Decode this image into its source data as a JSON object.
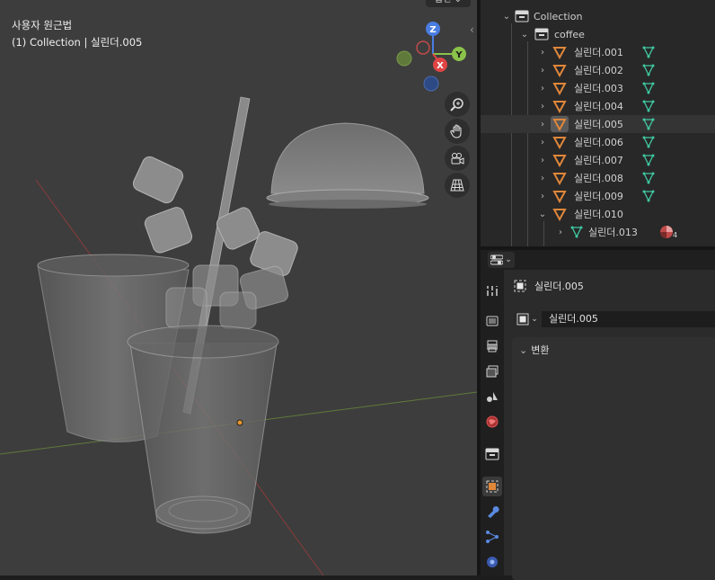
{
  "viewport": {
    "title": "사용자 원근법",
    "subtitle": "(1) Collection | 실린더.005",
    "top_menu": "옵션",
    "gizmo": {
      "z": "Z",
      "y": "Y",
      "x": "X"
    },
    "buttons": [
      "zoom-icon",
      "hand-icon",
      "camera-icon",
      "grid-icon"
    ],
    "colors": {
      "background": "#3d3d3d",
      "x_axis": "#e04545",
      "y_axis": "#8ac24a",
      "z_axis": "#4a7de0"
    }
  },
  "outliner": {
    "items": [
      {
        "label": "Collection",
        "indent": 1,
        "icon": "collection-icon",
        "expanded": true
      },
      {
        "label": "coffee",
        "indent": 2,
        "icon": "collection-icon",
        "expanded": true
      },
      {
        "label": "실린더.001",
        "indent": 3,
        "icon": "mesh-object-icon"
      },
      {
        "label": "실린더.002",
        "indent": 3,
        "icon": "mesh-object-icon"
      },
      {
        "label": "실린더.003",
        "indent": 3,
        "icon": "mesh-object-icon"
      },
      {
        "label": "실린더.004",
        "indent": 3,
        "icon": "mesh-object-icon"
      },
      {
        "label": "실린더.005",
        "indent": 3,
        "icon": "mesh-object-icon",
        "selected": true
      },
      {
        "label": "실린더.006",
        "indent": 3,
        "icon": "mesh-object-icon"
      },
      {
        "label": "실린더.007",
        "indent": 3,
        "icon": "mesh-object-icon"
      },
      {
        "label": "실린더.008",
        "indent": 3,
        "icon": "mesh-object-icon"
      },
      {
        "label": "실린더.009",
        "indent": 3,
        "icon": "mesh-object-icon"
      },
      {
        "label": "실린더.010",
        "indent": 3,
        "icon": "mesh-object-icon",
        "expanded": true
      },
      {
        "label": "실린더.013",
        "indent": 4,
        "icon": "mesh-data-icon",
        "badge": "4"
      }
    ]
  },
  "properties": {
    "object_name": "실린더.005",
    "data_name": "실린더.005",
    "panel_title": "변환",
    "tabs": [
      "tool-icon",
      "render-icon",
      "output-icon",
      "view-layer-icon",
      "scene-icon",
      "world-icon",
      "collection-icon",
      "object-icon",
      "modifier-icon",
      "particles-icon",
      "physics-icon"
    ]
  }
}
